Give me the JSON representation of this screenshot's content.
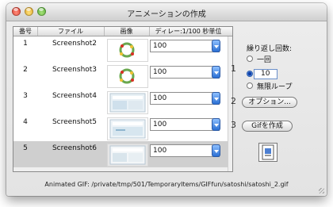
{
  "window": {
    "title": "アニメーションの作成"
  },
  "table": {
    "headers": [
      "番号",
      "ファイル",
      "画像",
      "ディレー:1/100 秒単位"
    ],
    "rows": [
      {
        "num": "1",
        "file": "Screenshot2",
        "delay": "100",
        "selected": false
      },
      {
        "num": "2",
        "file": "Screenshot3",
        "delay": "100",
        "selected": false
      },
      {
        "num": "3",
        "file": "Screenshot4",
        "delay": "100",
        "selected": false
      },
      {
        "num": "4",
        "file": "Screenshot5",
        "delay": "100",
        "selected": false
      },
      {
        "num": "5",
        "file": "Screenshot6",
        "delay": "100",
        "selected": true
      }
    ]
  },
  "side": {
    "step1": "1",
    "step2": "2",
    "step3": "3",
    "repeat_label": "繰り返し回数:",
    "option_once": "一回",
    "count_value": "10",
    "option_infinite": "無限ループ",
    "options_button": "オプション...",
    "create_button": "Gifを作成"
  },
  "status": "Animated GIF: /private/tmp/501/TemporaryItems/GIFfun/satoshi/satoshi_2.gif",
  "colors": {
    "accent": "#2a6fd3",
    "selection": "#cfcfcf"
  }
}
